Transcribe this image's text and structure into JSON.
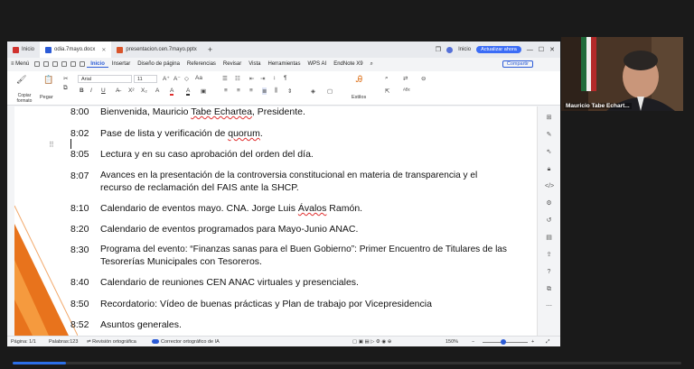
{
  "tabs": [
    {
      "label": "Inicio"
    },
    {
      "label": "odia.7mayo.docx"
    },
    {
      "label": "presentacion.cen.7mayo.pptx"
    }
  ],
  "titlebar": {
    "inicio_label": "Inicio",
    "ai_button": "Actualizar ahora"
  },
  "menu": {
    "menu_label": "Menú",
    "items": [
      "Inicio",
      "Insertar",
      "Diseño de página",
      "Referencias",
      "Revisar",
      "Vista",
      "Herramientas",
      "WPS AI",
      "EndNote X9"
    ],
    "share_label": "Compartir"
  },
  "ribbon": {
    "paste_label": "Copiar formato",
    "paste2_label": "Pegar",
    "font_name": "Arial",
    "font_size": "11",
    "edit_label": "Estilos"
  },
  "document": {
    "items": [
      {
        "time": "8:00",
        "text": "Bienvenida, Mauricio ",
        "squig": "Tabe Echartea",
        "after": ", Presidente."
      },
      {
        "time": "8:02",
        "text": "Pase de lista y verificación de ",
        "squig": "quorum",
        "after": "."
      },
      {
        "time": "8:05",
        "text": "Lectura y en su caso aprobación del orden del día.",
        "squig": "",
        "after": ""
      },
      {
        "time": "8:07",
        "text": "Avances en la presentación de la controversia constitucional en materia de transparencia y  el",
        "text2": "recurso de reclamación del FAIS ante la SHCP."
      },
      {
        "time": "8:10",
        "text": "Calendario de eventos mayo. CNA. Jorge Luis ",
        "squig": "Ávalos",
        "after": " Ramón."
      },
      {
        "time": "8:20",
        "text": "Calendario de eventos programados para Mayo-Junio ANAC."
      },
      {
        "time": "8:30",
        "text": "Programa del evento: “Finanzas sanas para el Buen Gobierno”: Primer Encuentro de Titulares de las",
        "text2": "Tesorerías Municipales con Tesoreros."
      },
      {
        "time": "8:40",
        "text": "Calendario de reuniones CEN ANAC virtuales y presenciales."
      },
      {
        "time": "8:50",
        "text": "Recordatorio: Vídeo de buenas prácticas y Plan de trabajo por Vicepresidencia"
      },
      {
        "time": "8:52",
        "text": "Asuntos generales."
      }
    ]
  },
  "status": {
    "page": "Página: 1/1",
    "words": "Palabras:123",
    "spell": "Revisión ortográfica",
    "ai_spell": "Corrector ortográfico de IA",
    "zoom": "150%"
  },
  "video": {
    "name": "Mauricio Tabe Echart..."
  },
  "playback_progress": 0.08,
  "colors": {
    "accent": "#2b5bd7",
    "orange": "#e8731c",
    "spell_error": "#e03030"
  }
}
